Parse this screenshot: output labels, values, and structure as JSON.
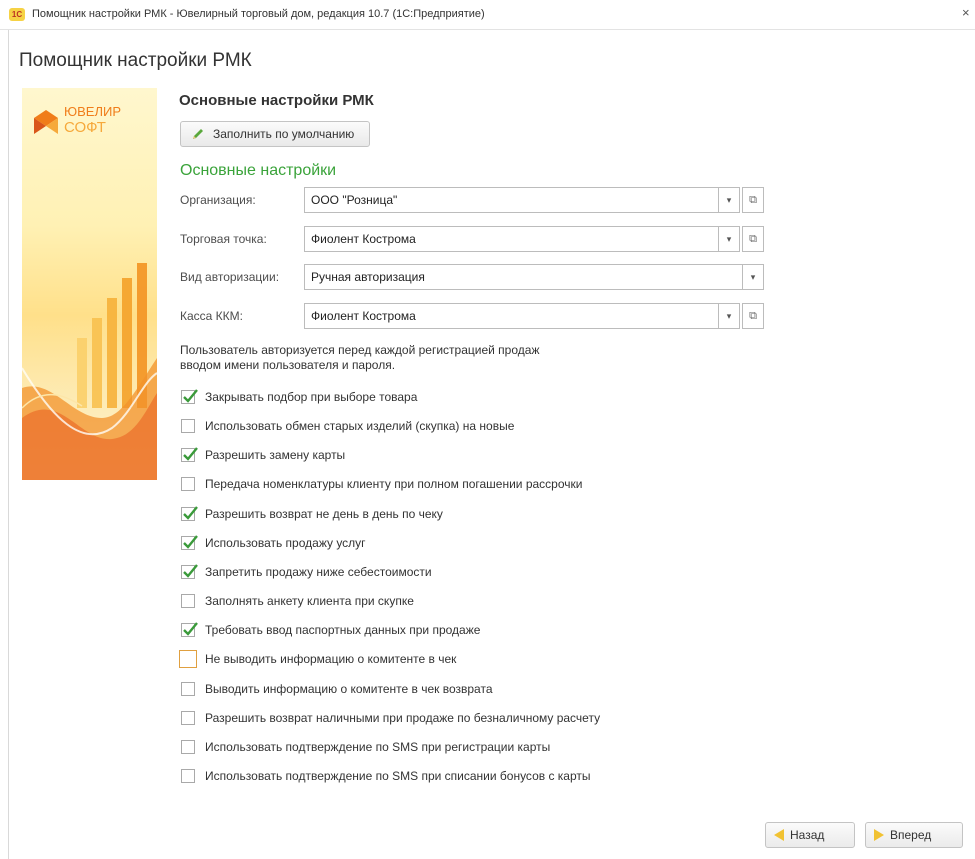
{
  "window": {
    "title": "Помощник настройки РМК - Ювелирный торговый дом, редакция 10.7  (1С:Предприятие)",
    "close_glyph": "×",
    "app_icon_text": "1С"
  },
  "page_title": "Помощник настройки РМК",
  "brand": {
    "line1": "ЮВЕЛИР",
    "line2": "СОФТ"
  },
  "section_title": "Основные настройки РМК",
  "fill_default_label": "Заполнить по умолчанию",
  "group_title": "Основные настройки",
  "fields": {
    "organization": {
      "label": "Организация:",
      "value": "ООО \"Розница\""
    },
    "trade_point": {
      "label": "Торговая точка:",
      "value": "Фиолент Кострома"
    },
    "auth_type": {
      "label": "Вид авторизации:",
      "value": "Ручная авторизация"
    },
    "kkm": {
      "label": "Касса ККМ:",
      "value": "Фиолент Кострома"
    }
  },
  "auth_info": {
    "line1": "Пользователь авторизуется перед каждой регистрацией продаж",
    "line2": "вводом имени пользователя и пароля."
  },
  "options": [
    {
      "label": "Закрывать подбор при выборе товара",
      "checked": true
    },
    {
      "label": "Использовать обмен старых изделий (скупка) на новые",
      "checked": false
    },
    {
      "label": "Разрешить замену карты",
      "checked": true
    },
    {
      "label": "Передача номенклатуры клиенту при полном погашении рассрочки",
      "checked": false
    },
    {
      "label": "Разрешить возврат не день в день по чеку",
      "checked": true
    },
    {
      "label": "Использовать продажу услуг",
      "checked": true
    },
    {
      "label": "Запретить продажу ниже себестоимости",
      "checked": true
    },
    {
      "label": "Заполнять анкету клиента при скупке",
      "checked": false
    },
    {
      "label": "Требовать ввод паспортных данных при продаже",
      "checked": true
    },
    {
      "label": "Не выводить информацию о комитенте в чек",
      "checked": false,
      "focused": true
    },
    {
      "label": "Выводить информацию о комитенте в чек возврата",
      "checked": false
    },
    {
      "label": "Разрешить возврат наличными при продаже по безналичному расчету",
      "checked": false
    },
    {
      "label": "Использовать подтверждение по SMS при регистрации карты",
      "checked": false
    },
    {
      "label": "Использовать подтверждение по SMS при списании бонусов с карты",
      "checked": false
    }
  ],
  "nav": {
    "back_label": "Назад",
    "forward_label": "Вперед"
  },
  "colors": {
    "accent_green": "#3aa33a",
    "check_green": "#3a9a3a",
    "brand_orange": "#f07d1a"
  }
}
